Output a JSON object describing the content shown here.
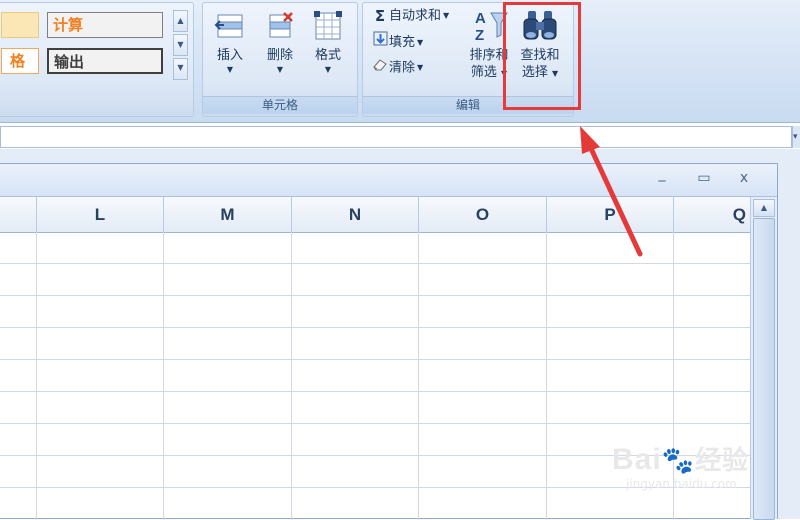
{
  "styles": {
    "row1_label": "计算",
    "row2_left_label": "格",
    "row2_label": "输出",
    "calc_color": "#f08020"
  },
  "cells_group": {
    "label": "单元格",
    "insert": "插入",
    "delete": "删除",
    "format": "格式"
  },
  "edit_group": {
    "label": "编辑",
    "autosum": "自动求和",
    "fill": "填充",
    "clear": "清除",
    "sort_filter_line1": "排序和",
    "sort_filter_line2": "筛选",
    "find_select_line1": "查找和",
    "find_select_line2": "选择"
  },
  "window": {
    "minimize": "_",
    "restore": "▭",
    "close": "x"
  },
  "columns": [
    "L",
    "M",
    "N",
    "O",
    "P",
    "Q"
  ],
  "watermark": {
    "brand": "Bai",
    "brand_suffix": "经验",
    "url": "jingyan.baidu.com"
  },
  "annotation": {
    "color": "#e53a3a"
  }
}
